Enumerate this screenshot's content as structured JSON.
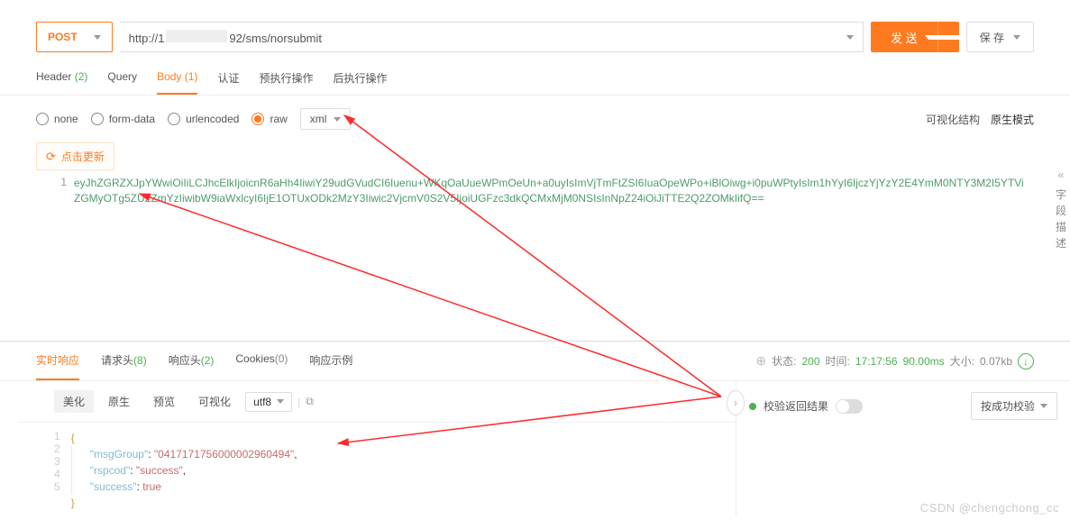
{
  "request": {
    "method": "POST",
    "url_prefix": "http://1",
    "url_suffix": "92/sms/norsubmit",
    "send_label": "发 送",
    "save_label": "保 存"
  },
  "req_tabs": {
    "header": {
      "label": "Header",
      "count": "(2)"
    },
    "query": {
      "label": "Query"
    },
    "body": {
      "label": "Body",
      "count": "(1)"
    },
    "auth": {
      "label": "认证"
    },
    "pre": {
      "label": "预执行操作"
    },
    "post": {
      "label": "后执行操作"
    }
  },
  "body_types": {
    "none": "none",
    "formdata": "form-data",
    "urlencoded": "urlencoded",
    "raw": "raw",
    "raw_subtype": "xml",
    "visual_struct": "可视化结构",
    "native_mode": "原生模式"
  },
  "refresh_btn": "点击更新",
  "request_editor": {
    "line_no": "1",
    "content": "eyJhZGRZXJpYWwiOiIiLCJhcElkIjoicnR6aHh4IiwiY29udGVudCI6Iuenu+WKqOaUueWPmOeUn+a0uyIsImVjTmFtZSI6IuaOpeWPo+iBlOiwg+i0puWPtyIsIm1hYyI6IjczYjYzY2E4YmM0NTY3M2I5YTViZGMyOTg5ZU2ZmYzIiwibW9iaWxlcyI6IjE1OTUxODk2MzY3Iiwic2VjcmV0S2V5IjoiUGFzc3dkQCMxMjM0NSIsInNpZ24iOiJiTTE2Q2ZOMkIifQ=="
  },
  "side_meta": {
    "chevrons": "«",
    "text": "字段描述"
  },
  "resp_tabs": {
    "realtime": "实时响应",
    "reqhdr": {
      "label": "请求头",
      "count": "(8)"
    },
    "resphdr": {
      "label": "响应头",
      "count": "(2)"
    },
    "cookies": {
      "label": "Cookies",
      "count": "(0)"
    },
    "example": "响应示例"
  },
  "resp_meta": {
    "status_label": "状态:",
    "status_value": "200",
    "time_label": "时间:",
    "time_value": "17:17:56",
    "duration": "90.00ms",
    "size_label": "大小:",
    "size_value": "0.07kb"
  },
  "resp_view": {
    "pretty": "美化",
    "raw": "原生",
    "preview": "预览",
    "visual": "可视化",
    "encoding": "utf8"
  },
  "resp_json": {
    "l1": "{",
    "l2_key": "\"msgGroup\"",
    "l2_val": "\"0417171756000002960494\"",
    "l3_key": "\"rspcod\"",
    "l3_val": "\"success\"",
    "l4_key": "\"success\"",
    "l4_val": "true",
    "l5": "}"
  },
  "validate": {
    "label": "校验返回结果",
    "button": "按成功校验"
  },
  "watermark": "CSDN @chengchong_cc"
}
